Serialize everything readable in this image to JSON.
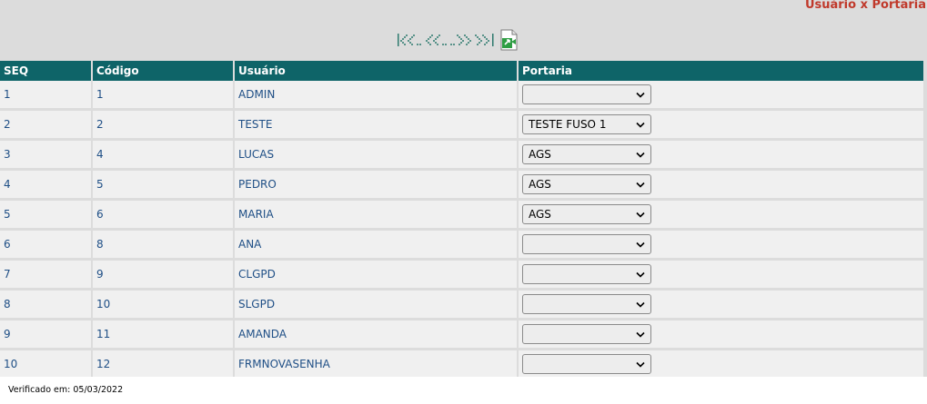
{
  "page_title": "Usuário x Portaria",
  "navigation": {
    "first_icon": "first-page-icon",
    "prev_icon": "previous-page-icon",
    "next_icon": "next-page-icon",
    "last_icon": "last-page-icon",
    "export_icon": "export-excel-icon"
  },
  "table": {
    "headers": {
      "seq": "SEQ",
      "codigo": "Código",
      "usuario": "Usuário",
      "portaria": "Portaria"
    },
    "rows": [
      {
        "seq": "1",
        "codigo": "1",
        "usuario": "ADMIN",
        "portaria": ""
      },
      {
        "seq": "2",
        "codigo": "2",
        "usuario": "TESTE",
        "portaria": "TESTE FUSO 1"
      },
      {
        "seq": "3",
        "codigo": "4",
        "usuario": "LUCAS",
        "portaria": "AGS"
      },
      {
        "seq": "4",
        "codigo": "5",
        "usuario": "PEDRO",
        "portaria": "AGS"
      },
      {
        "seq": "5",
        "codigo": "6",
        "usuario": "MARIA",
        "portaria": "AGS"
      },
      {
        "seq": "6",
        "codigo": "8",
        "usuario": "ANA",
        "portaria": ""
      },
      {
        "seq": "7",
        "codigo": "9",
        "usuario": "CLGPD",
        "portaria": ""
      },
      {
        "seq": "8",
        "codigo": "10",
        "usuario": "SLGPD",
        "portaria": ""
      },
      {
        "seq": "9",
        "codigo": "11",
        "usuario": "AMANDA",
        "portaria": ""
      },
      {
        "seq": "10",
        "codigo": "12",
        "usuario": "FRMNOVASENHA",
        "portaria": ""
      }
    ]
  },
  "footer": {
    "verified": "Verificado em: 05/03/2022"
  },
  "colors": {
    "header_bg": "#0e6468",
    "title": "#c0392b",
    "link": "#1f4f86",
    "row_bg": "#f0f0f0"
  }
}
